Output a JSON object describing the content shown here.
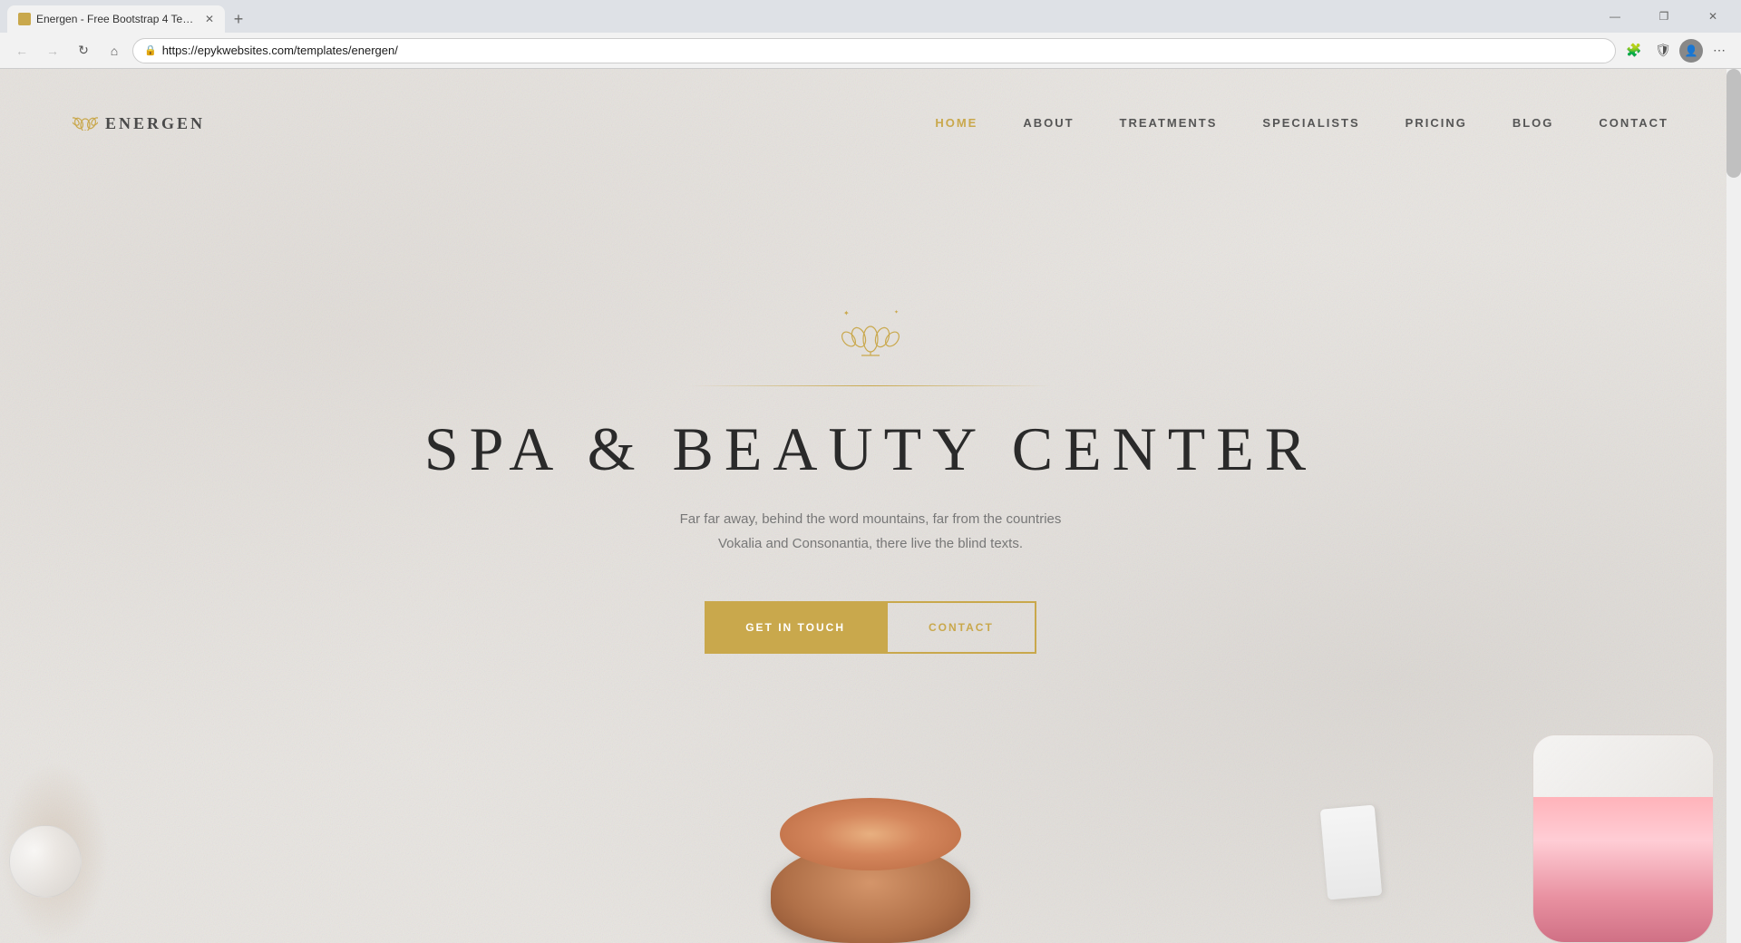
{
  "browser": {
    "tab": {
      "title": "Energen - Free Bootstrap 4 Tem...",
      "favicon": "E"
    },
    "address": "https://epykwebsites.com/templates/energen/",
    "window_controls": {
      "minimize": "—",
      "maximize": "□",
      "close": "✕"
    }
  },
  "nav": {
    "logo": {
      "icon": "✿",
      "text": "ENERGEN"
    },
    "items": [
      {
        "label": "HOME",
        "active": true
      },
      {
        "label": "ABOUT",
        "active": false
      },
      {
        "label": "TREATMENTS",
        "active": false
      },
      {
        "label": "SPECIALISTS",
        "active": false
      },
      {
        "label": "PRICING",
        "active": false
      },
      {
        "label": "BLOG",
        "active": false
      },
      {
        "label": "CONTACT",
        "active": false
      }
    ]
  },
  "hero": {
    "title": "SPA & BEAUTY CENTER",
    "subtitle_line1": "Far far away, behind the word mountains, far from the countries",
    "subtitle_line2": "Vokalia and Consonantia, there live the blind texts.",
    "btn_primary": "GET IN TOUCH",
    "btn_secondary": "CONTACT"
  }
}
